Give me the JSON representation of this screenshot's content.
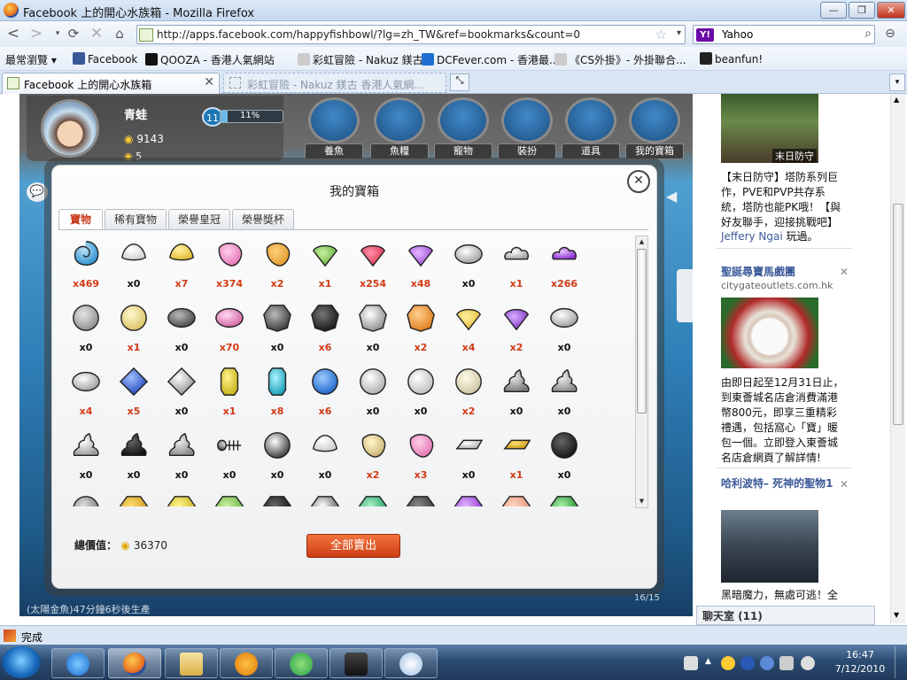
{
  "window": {
    "title": "Facebook 上的開心水族箱 - Mozilla Firefox",
    "buttons": [
      "—",
      "❐",
      "✕"
    ]
  },
  "nav": {
    "url": "http://apps.facebook.com/happyfishbowl/?lg=zh_TW&ref=bookmarks&count=0",
    "search_value": "Yahoo",
    "search_engine": "Y!"
  },
  "bookmarks": [
    {
      "label": "最常瀏覽 ▾",
      "icon": "none",
      "color": "transparent"
    },
    {
      "label": "Facebook",
      "icon": "facebook-icon",
      "color": "#3b5998"
    },
    {
      "label": "QOOZA - 香港人氣網站",
      "icon": "qooza-icon",
      "color": "#111111"
    },
    {
      "label": "彩虹冒險 - Nakuz 鎂古...",
      "icon": "page-icon",
      "color": "#cccccc"
    },
    {
      "label": "DCFever.com - 香港最...",
      "icon": "dcfever-icon",
      "color": "#1e6fd0"
    },
    {
      "label": "《CS外掛》- 外掛聯合...",
      "icon": "page-icon",
      "color": "#cccccc"
    },
    {
      "label": "beanfun!",
      "icon": "beanfun-icon",
      "color": "#222222"
    }
  ],
  "tabs": [
    {
      "label": "Facebook 上的開心水族箱"
    },
    {
      "label": "彩虹冒險 - Nakuz 鎂古 香港人氣網..."
    }
  ],
  "game": {
    "user_name": "青蛙",
    "coins": "9143",
    "coins2": "5",
    "level": "11",
    "xp_text": "11%",
    "xp_fraction": 0.11,
    "buttons": [
      "養魚",
      "魚糧",
      "寵物",
      "裝扮",
      "道具",
      "我的寶箱"
    ],
    "status_text": "(太陽金魚)47分鐘6秒後生產",
    "fish_count": "16/15"
  },
  "modal": {
    "title": "我的寶箱",
    "close": "✕",
    "tabs": [
      "寶物",
      "稀有寶物",
      "榮譽皇冠",
      "榮譽獎杯"
    ],
    "active_tab": 0,
    "total_label": "總價值：",
    "total_value": "36370",
    "sell_all": "全部賣出"
  },
  "items": [
    {
      "name": "blue-shell-icon",
      "count": "x469",
      "c1": "#b9e2f7",
      "c2": "#2a8fd0",
      "shape": "shell"
    },
    {
      "name": "white-shell-icon",
      "count": "x0",
      "c1": "#ffffff",
      "c2": "#cfcfcf",
      "shape": "scallop"
    },
    {
      "name": "yellow-shell-icon",
      "count": "x7",
      "c1": "#fff0a0",
      "c2": "#e0b830",
      "shape": "scallop"
    },
    {
      "name": "pink-shell-icon",
      "count": "x374",
      "c1": "#ffd0ea",
      "c2": "#e070b0",
      "shape": "conch"
    },
    {
      "name": "orange-shell-icon",
      "count": "x2",
      "c1": "#ffd27a",
      "c2": "#e0952a",
      "shape": "conch"
    },
    {
      "name": "green-shell-icon",
      "count": "x1",
      "c1": "#c8f0a0",
      "c2": "#5fae3a",
      "shape": "fan"
    },
    {
      "name": "red-shell-icon",
      "count": "x254",
      "c1": "#ff90a8",
      "c2": "#d8304e",
      "shape": "fan"
    },
    {
      "name": "purple-shell-icon",
      "count": "x48",
      "c1": "#e2b8ff",
      "c2": "#9a44d8",
      "shape": "fan"
    },
    {
      "name": "white-stone-icon",
      "count": "x0",
      "c1": "#ffffff",
      "c2": "#9a9a9a",
      "shape": "oval"
    },
    {
      "name": "white-cloud-icon",
      "count": "x1",
      "c1": "#ffffff",
      "c2": "#a0a0a0",
      "shape": "cloud"
    },
    {
      "name": "purple-cloud-icon",
      "count": "x266",
      "c1": "#e6c2ff",
      "c2": "#8a2cd0",
      "shape": "cloud"
    },
    {
      "name": "gray-pearl-icon",
      "count": "x0",
      "c1": "#e6e6e6",
      "c2": "#8a8a8a",
      "shape": "round"
    },
    {
      "name": "cream-pearl-icon",
      "count": "x1",
      "c1": "#fff8d0",
      "c2": "#d8c060",
      "shape": "round"
    },
    {
      "name": "dark-stone-icon",
      "count": "x0",
      "c1": "#bbbbbb",
      "c2": "#444444",
      "shape": "oval"
    },
    {
      "name": "pink-pearl-icon",
      "count": "x70",
      "c1": "#ffd8ef",
      "c2": "#d060a0",
      "shape": "oval"
    },
    {
      "name": "gray-crystal-icon",
      "count": "x0",
      "c1": "#bbbbbb",
      "c2": "#333333",
      "shape": "gem"
    },
    {
      "name": "black-crystal-icon",
      "count": "x6",
      "c1": "#777777",
      "c2": "#111111",
      "shape": "gem"
    },
    {
      "name": "white-crystal-icon",
      "count": "x0",
      "c1": "#ffffff",
      "c2": "#888888",
      "shape": "gem"
    },
    {
      "name": "orange-crystal-icon",
      "count": "x2",
      "c1": "#ffd090",
      "c2": "#e07a1a",
      "shape": "gem"
    },
    {
      "name": "gold-fan-shell-icon",
      "count": "x4",
      "c1": "#fff0a0",
      "c2": "#e0b830",
      "shape": "fan"
    },
    {
      "name": "purple-fan-shell-icon",
      "count": "x2",
      "c1": "#d8b0ff",
      "c2": "#7a2cc0",
      "shape": "fan"
    },
    {
      "name": "white-gem-oval-icon",
      "count": "x0",
      "c1": "#ffffff",
      "c2": "#999999",
      "shape": "oval"
    },
    {
      "name": "white-marquise-icon",
      "count": "x4",
      "c1": "#ffffff",
      "c2": "#999999",
      "shape": "oval"
    },
    {
      "name": "blue-square-gem-icon",
      "count": "x5",
      "c1": "#9ec0ff",
      "c2": "#1a3fb8",
      "shape": "square"
    },
    {
      "name": "white-square-gem-icon",
      "count": "x0",
      "c1": "#ffffff",
      "c2": "#888888",
      "shape": "square"
    },
    {
      "name": "yellow-crystal-icon",
      "count": "x1",
      "c1": "#fff48a",
      "c2": "#c8b01a",
      "shape": "prism"
    },
    {
      "name": "teal-crystal-icon",
      "count": "x8",
      "c1": "#aef3ff",
      "c2": "#1aa0b8",
      "shape": "prism"
    },
    {
      "name": "blue-diamond-icon",
      "count": "x6",
      "c1": "#9ecbff",
      "c2": "#1a62c8",
      "shape": "round"
    },
    {
      "name": "white-diamond-icon",
      "count": "x0",
      "c1": "#ffffff",
      "c2": "#aaaaaa",
      "shape": "round"
    },
    {
      "name": "clear-diamond-icon",
      "count": "x0",
      "c1": "#ffffff",
      "c2": "#bbbbbb",
      "shape": "round"
    },
    {
      "name": "ivory-diamond-icon",
      "count": "x2",
      "c1": "#fffce8",
      "c2": "#c8c0a0",
      "shape": "round"
    },
    {
      "name": "gray-swirl-icon",
      "count": "x0",
      "c1": "#e6e6e6",
      "c2": "#777777",
      "shape": "swirl"
    },
    {
      "name": "silver-swirl-icon",
      "count": "x0",
      "c1": "#eeeeee",
      "c2": "#888888",
      "shape": "swirl"
    },
    {
      "name": "white-swirl-icon",
      "count": "x0",
      "c1": "#ffffff",
      "c2": "#999999",
      "shape": "swirl"
    },
    {
      "name": "black-swirl-icon",
      "count": "x0",
      "c1": "#666666",
      "c2": "#111111",
      "shape": "swirl"
    },
    {
      "name": "gray-swirl-2-icon",
      "count": "x0",
      "c1": "#eeeeee",
      "c2": "#888888",
      "shape": "swirl"
    },
    {
      "name": "fish-skeleton-icon",
      "count": "x0",
      "c1": "#ffffff",
      "c2": "#222222",
      "shape": "bone"
    },
    {
      "name": "white-orb-icon",
      "count": "x0",
      "c1": "#ffffff",
      "c2": "#333333",
      "shape": "round"
    },
    {
      "name": "white-fragment-icon",
      "count": "x0",
      "c1": "#ffffff",
      "c2": "#cccccc",
      "shape": "scallop"
    },
    {
      "name": "cream-conch-icon",
      "count": "x2",
      "c1": "#fff6c8",
      "c2": "#c8b070",
      "shape": "conch"
    },
    {
      "name": "pink-conch-icon",
      "count": "x3",
      "c1": "#ffd0e8",
      "c2": "#e070b0",
      "shape": "conch"
    },
    {
      "name": "silver-bar-icon",
      "count": "x0",
      "c1": "#ffffff",
      "c2": "#aaaaaa",
      "shape": "bar"
    },
    {
      "name": "gold-bar-icon",
      "count": "x1",
      "c1": "#ffe070",
      "c2": "#c89018",
      "shape": "bar"
    },
    {
      "name": "black-pearl-icon",
      "count": "x0",
      "c1": "#666666",
      "c2": "#111111",
      "shape": "round"
    },
    {
      "name": "silver-item-icon",
      "count": "",
      "c1": "#dddddd",
      "c2": "#777777",
      "shape": "round"
    },
    {
      "name": "gold-item-icon",
      "count": "",
      "c1": "#ffe070",
      "c2": "#c89018",
      "shape": "gem"
    },
    {
      "name": "yellow-item-icon",
      "count": "",
      "c1": "#fff48a",
      "c2": "#c8b01a",
      "shape": "gem"
    },
    {
      "name": "green-item-icon",
      "count": "",
      "c1": "#c8f0a0",
      "c2": "#5fae3a",
      "shape": "gem"
    },
    {
      "name": "black-item-icon",
      "count": "",
      "c1": "#666666",
      "c2": "#111111",
      "shape": "gem"
    },
    {
      "name": "white-item-icon",
      "count": "",
      "c1": "#ffffff",
      "c2": "#555555",
      "shape": "gem"
    },
    {
      "name": "emerald-item-icon",
      "count": "",
      "c1": "#a8f0c8",
      "c2": "#1a9a5a",
      "shape": "gem"
    },
    {
      "name": "dark-item-icon",
      "count": "",
      "c1": "#888888",
      "c2": "#333333",
      "shape": "gem"
    },
    {
      "name": "violet-item-icon",
      "count": "",
      "c1": "#e2b8ff",
      "c2": "#8a2cd0",
      "shape": "gem"
    },
    {
      "name": "peach-item-icon",
      "count": "",
      "c1": "#ffd8c8",
      "c2": "#e08a6a",
      "shape": "gem"
    },
    {
      "name": "green-leaf-item-icon",
      "count": "",
      "c1": "#a8f0a8",
      "c2": "#1a8a2a",
      "shape": "gem"
    }
  ],
  "count_colors": {
    "zero": "#111111",
    "nonzero": "#d23a14"
  },
  "sidebar": {
    "ad1": {
      "caption": "末日防守",
      "text": "【末日防守】塔防系列巨作，PVE和PVP共存系統，塔防也能PK哦！【與好友聯手，迎接挑戰吧】",
      "liker": "Jeffery Ngai",
      "liker_suffix": "玩過。"
    },
    "ad2": {
      "title": "聖誕尋寶馬戲團",
      "url": "citygateoutlets.com.hk",
      "text": "由即日起至12月31日止，到東薈城名店倉消費滿港幣800元，即享三重精彩禮遇，包括窩心「寶」暖包一個。立即登入東薈城名店倉網頁了解詳情!"
    },
    "ad3": {
      "title": "哈利波特– 死神的聖物1",
      "text": "黑暗魔力，無處可逃！全"
    },
    "close": "✕"
  },
  "chat": {
    "label": "聊天室 (11)"
  },
  "status": {
    "text": "完成"
  },
  "clock": {
    "time": "16:47",
    "date": "7/12/2010"
  }
}
